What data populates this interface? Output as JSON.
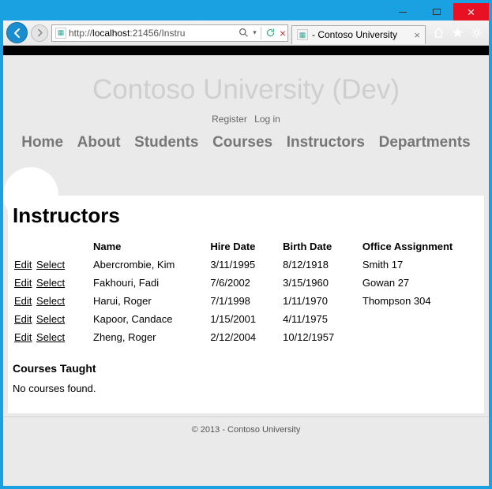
{
  "browser": {
    "url_prefix": "http://",
    "url_host": "localhost",
    "url_port_path": ":21456/Instru",
    "tab_title": " - Contoso University"
  },
  "site": {
    "brand": "Contoso University  (Dev)",
    "auth": {
      "register": "Register",
      "login": "Log in"
    },
    "nav": [
      "Home",
      "About",
      "Students",
      "Courses",
      "Instructors",
      "Departments"
    ]
  },
  "page": {
    "heading": "Instructors",
    "columns": [
      "Name",
      "Hire Date",
      "Birth Date",
      "Office Assignment"
    ],
    "actions": {
      "edit": "Edit",
      "select": "Select"
    },
    "rows": [
      {
        "name": "Abercrombie, Kim",
        "hire": "3/11/1995",
        "birth": "8/12/1918",
        "office": "Smith 17"
      },
      {
        "name": "Fakhouri, Fadi",
        "hire": "7/6/2002",
        "birth": "3/15/1960",
        "office": "Gowan 27"
      },
      {
        "name": "Harui, Roger",
        "hire": "7/1/1998",
        "birth": "1/11/1970",
        "office": "Thompson 304"
      },
      {
        "name": "Kapoor, Candace",
        "hire": "1/15/2001",
        "birth": "4/11/1975",
        "office": ""
      },
      {
        "name": "Zheng, Roger",
        "hire": "2/12/2004",
        "birth": "10/12/1957",
        "office": ""
      }
    ],
    "subheading": "Courses Taught",
    "no_courses_msg": "No courses found."
  },
  "footer": "© 2013 - Contoso University"
}
